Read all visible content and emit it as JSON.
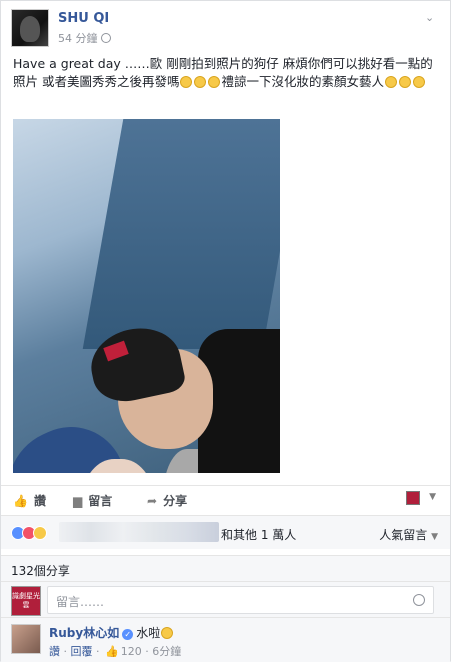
{
  "post": {
    "author": "SHU QI",
    "time": "54 分鐘",
    "text_main": "Have a great day ……歐 剛剛拍到照片的狗仔 麻煩你們可以挑好看一點的照片 或者美圖秀秀之後再發嗎",
    "text_tail": "禮諒一下沒化妝的素顏女藝人"
  },
  "actions": {
    "like": "讚",
    "comment": "留言",
    "share": "分享"
  },
  "summary": {
    "others": "和其他 1 萬人",
    "sort": "人氣留言"
  },
  "shares": {
    "count": "132個分享"
  },
  "composer": {
    "placeholder": "留言……",
    "page_avatar_text": "識劇星光雲"
  },
  "comment": {
    "author": "Ruby林心如",
    "text": "水啦",
    "like": "讚",
    "reply": "回覆",
    "likes": "120",
    "time": "6分鐘"
  }
}
